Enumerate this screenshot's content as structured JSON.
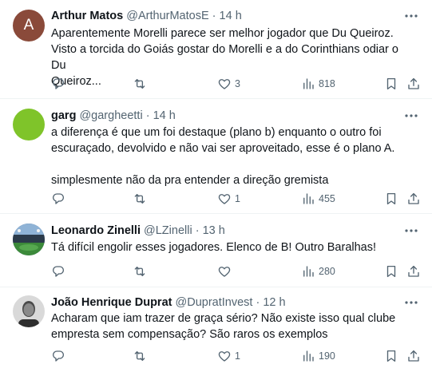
{
  "tweets": [
    {
      "name": "Arthur Matos",
      "handle": "@ArthurMatosE",
      "dot": "·",
      "time": "14 h",
      "avatar": {
        "type": "letter",
        "letter": "A",
        "bg": "#8a4a3a"
      },
      "lines": [
        "Aparentemente Morelli parece ser melhor jogador que Du Queiroz.",
        "Visto a torcida do Goiás gostar do Morelli e a do Corinthians odiar o Du",
        "Queiroz..."
      ],
      "replies": "",
      "retweets": "",
      "likes": "3",
      "views": "818"
    },
    {
      "name": "garg",
      "handle": "@gargheetti",
      "dot": "·",
      "time": "14 h",
      "avatar": {
        "type": "solid",
        "bg": "#7fc42a"
      },
      "lines": [
        "a diferença é que um foi destaque (plano b) enquanto o outro foi",
        "escuraçado, devolvido e não vai ser aproveitado, esse é o plano A.",
        "",
        "simplesmente não da pra entender a direção gremista"
      ],
      "replies": "",
      "retweets": "",
      "likes": "1",
      "views": "455"
    },
    {
      "name": "Leonardo Zinelli",
      "handle": "@LZinelli",
      "dot": "·",
      "time": "13 h",
      "avatar": {
        "type": "photo-stadium"
      },
      "lines": [
        "Tá difícil engolir esses jogadores. Elenco de B! Outro Baralhas!"
      ],
      "replies": "",
      "retweets": "",
      "likes": "",
      "views": "280"
    },
    {
      "name": "João Henrique Duprat",
      "handle": "@DupratInvest",
      "dot": "·",
      "time": "12 h",
      "avatar": {
        "type": "photo-person"
      },
      "lines": [
        "Acharam que iam trazer de graça sério? Não existe isso qual clube",
        "empresta sem compensação? São raros os exemplos"
      ],
      "replies": "",
      "retweets": "",
      "likes": "1",
      "views": "190"
    }
  ],
  "icons": {
    "reply": "reply-icon",
    "retweet": "retweet-icon",
    "like": "heart-icon",
    "views": "views-bar-chart-icon",
    "bookmark": "bookmark-icon",
    "share": "share-icon",
    "more": "more-options-icon"
  },
  "colors": {
    "text": "#0f1419",
    "secondary": "#536471",
    "divider": "#eff3f4"
  }
}
